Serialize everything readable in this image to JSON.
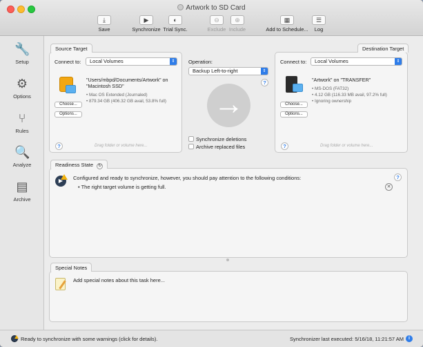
{
  "window": {
    "title": "Artwork to SD Card"
  },
  "toolbar": {
    "save": "Save",
    "synchronize": "Synchronize",
    "trial_sync": "Trial Sync.",
    "exclude": "Exclude",
    "include": "Include",
    "add_to_schedule": "Add to Schedule...",
    "log": "Log"
  },
  "sidebar": {
    "setup": "Setup",
    "options": "Options",
    "rules": "Rules",
    "analyze": "Analyze",
    "archive": "Archive"
  },
  "source": {
    "tab": "Source Target",
    "connect_label": "Connect to:",
    "connect_value": "Local Volumes",
    "path": "\"Users/mbpd/Documents/Artwork\" on \"Macintosh SSD\"",
    "path_line1": "\"Users/mbpd/Documents/Artwork\" on",
    "path_line2": "\"Macintosh SSD\"",
    "detail1": "• Mac OS Extended (Journaled)",
    "detail2": "• 879.34 GB (406.32 GB avail, 53.8% full)",
    "choose": "Choose...",
    "options": "Options...",
    "drag_hint": "Drag folder or volume here..."
  },
  "operation": {
    "label": "Operation:",
    "value": "Backup Left-to-right",
    "sync_deletions": "Synchronize deletions",
    "archive_replaced": "Archive replaced files"
  },
  "destination": {
    "tab": "Destination Target",
    "connect_label": "Connect to:",
    "connect_value": "Local Volumes",
    "path": "\"Artwork\" on \"TRANSFER\"",
    "detail1": "• MS-DOS (FAT32)",
    "detail2": "• 4.12 GB (116.33 MB avail, 97.2% full)",
    "detail3": "• Ignoring ownership",
    "choose": "Choose...",
    "options": "Options...",
    "drag_hint": "Drag folder or volume here..."
  },
  "readiness": {
    "tab": "Readiness State",
    "message": "Configured and ready to synchronize, however, you should pay attention to the following conditions:",
    "bullet": "• The right target volume is getting full."
  },
  "notes": {
    "tab": "Special Notes",
    "placeholder": "Add special notes about this task here..."
  },
  "status": {
    "message": "Ready to synchronize with some warnings (click for details).",
    "last_executed": "Synchronizer last executed:  5/16/18, 11:21:57 AM"
  }
}
